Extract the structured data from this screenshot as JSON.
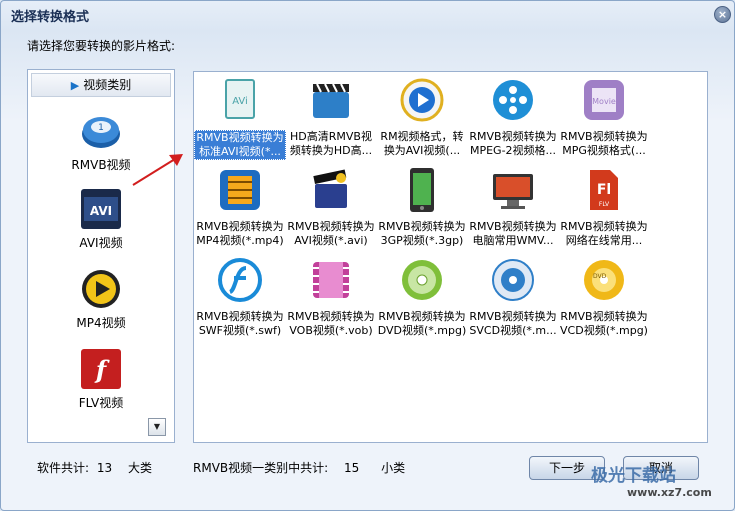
{
  "window": {
    "title": "选择转换格式",
    "close_glyph": "×"
  },
  "prompt": "请选择您要转换的影片格式:",
  "sidebar": {
    "header": "视频类别",
    "items": [
      {
        "label": "RMVB视频",
        "icon": "rmvb-icon"
      },
      {
        "label": "AVI视频",
        "icon": "avi-icon"
      },
      {
        "label": "MP4视频",
        "icon": "mp4-icon"
      },
      {
        "label": "FLV视频",
        "icon": "flv-icon"
      }
    ],
    "scroll_glyph": "▼"
  },
  "formats": [
    {
      "line1": "RMVB视频转换为",
      "line2": "标准AVI视频(*...",
      "icon": "avi-doc-icon",
      "color": "#4aa3a8",
      "selected": true
    },
    {
      "line1": "HD高清RMVB视",
      "line2": "频转换为HD高...",
      "icon": "clapper-icon",
      "color": "#2d7fc8"
    },
    {
      "line1": "RM视频格式，转",
      "line2": "换为AVI视频(...",
      "icon": "media-player-icon",
      "color": "#1f6fd0"
    },
    {
      "line1": "RMVB视频转换为",
      "line2": "MPEG-2视频格...",
      "icon": "film-reel-icon",
      "color": "#1f8fd6"
    },
    {
      "line1": "RMVB视频转换为",
      "line2": "MPG视频格式(...",
      "icon": "movie-icon",
      "color": "#9f7fc6"
    },
    {
      "line1": "RMVB视频转换为",
      "line2": "MP4视频(*.mp4)",
      "icon": "mp4-film-icon",
      "color": "#1d6cc0"
    },
    {
      "line1": "RMVB视频转换为",
      "line2": "AVI视频(*.avi)",
      "icon": "clapper-star-icon",
      "color": "#2a3f8f"
    },
    {
      "line1": "RMVB视频转换为",
      "line2": "3GP视频(*.3gp)",
      "icon": "phone-icon",
      "color": "#2f2f2f"
    },
    {
      "line1": "RMVB视频转换为",
      "line2": "电脑常用WMV...",
      "icon": "monitor-icon",
      "color": "#d94f2a"
    },
    {
      "line1": "RMVB视频转换为",
      "line2": "网络在线常用...",
      "icon": "flv-doc-icon",
      "color": "#d23a1c"
    },
    {
      "line1": "RMVB视频转换为",
      "line2": "SWF视频(*.swf)",
      "icon": "flash-icon",
      "color": "#1a8bd8"
    },
    {
      "line1": "RMVB视频转换为",
      "line2": "VOB视频(*.vob)",
      "icon": "vob-film-icon",
      "color": "#c2409a"
    },
    {
      "line1": "RMVB视频转换为",
      "line2": "DVD视频(*.mpg)",
      "icon": "disc-green-icon",
      "color": "#7fbf3a"
    },
    {
      "line1": "RMVB视频转换为",
      "line2": "SVCD视频(*.m...",
      "icon": "disc-blue-icon",
      "color": "#2f7fc8"
    },
    {
      "line1": "RMVB视频转换为",
      "line2": "VCD视频(*.mpg)",
      "icon": "disc-yellow-icon",
      "color": "#f0b818"
    }
  ],
  "footer": {
    "software_total_label": "软件共计:",
    "software_total": "13",
    "category_unit": "大类",
    "subtotal_label": "RMVB视频一类别中共计:",
    "subtotal": "15",
    "subtotal_unit": "小类"
  },
  "buttons": {
    "next": "下一步",
    "cancel": "取消"
  },
  "watermark": {
    "text": "极光下载站",
    "url": "www.xz7.com"
  }
}
